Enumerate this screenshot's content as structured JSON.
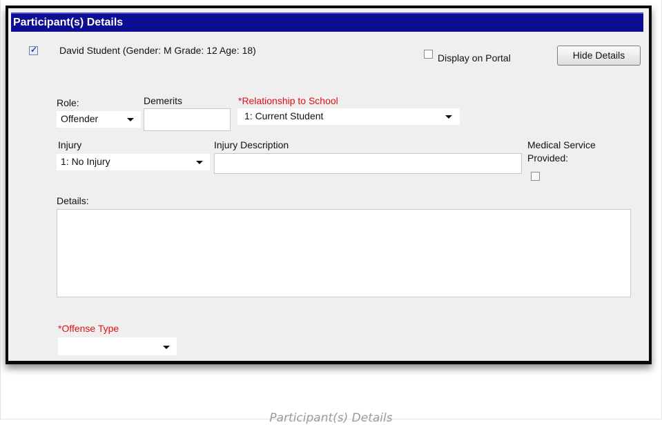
{
  "header": {
    "title": "Participant(s) Details"
  },
  "participant": {
    "checked": true,
    "label": "David Student (Gender: M Grade: 12 Age: 18)",
    "display_on_portal_label": "Display on Portal",
    "hide_details_label": "Hide Details"
  },
  "form": {
    "role": {
      "label": "Role:",
      "value": "Offender"
    },
    "demerits": {
      "label": "Demerits",
      "value": ""
    },
    "relationship": {
      "label": "*Relationship to School",
      "value": "1: Current Student"
    },
    "injury": {
      "label": "Injury",
      "value": "1: No Injury"
    },
    "injury_description": {
      "label": "Injury Description",
      "value": ""
    },
    "medical_service": {
      "label_line1": "Medical Service",
      "label_line2": "Provided:"
    },
    "details": {
      "label": "Details:",
      "value": ""
    },
    "offense_type": {
      "label": "*Offense Type",
      "value": ""
    }
  },
  "caption": "Participant(s) Details",
  "colors": {
    "header_bg": "#0d0d91",
    "required": "#e01010",
    "panel_bg": "#efefef"
  }
}
